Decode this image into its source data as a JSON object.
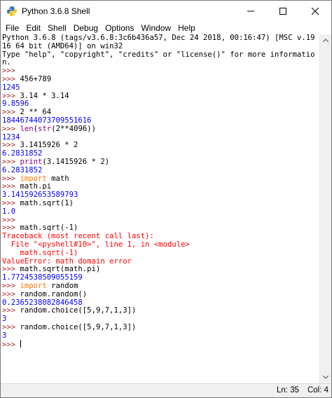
{
  "window": {
    "title": "Python 3.6.8 Shell"
  },
  "menu": [
    "File",
    "Edit",
    "Shell",
    "Debug",
    "Options",
    "Window",
    "Help"
  ],
  "shell_lines": [
    [
      {
        "t": "Python 3.6.8 (tags/v3.6.8:3c6b436a57, Dec 24 2018, 00:16:47) [MSC v.19",
        "c": "info"
      }
    ],
    [
      {
        "t": "16 64 bit (AMD64)] on win32",
        "c": "info"
      }
    ],
    [
      {
        "t": "Type \"help\", \"copyright\", \"credits\" or \"license()\" for more informatio",
        "c": "info"
      }
    ],
    [
      {
        "t": "n.",
        "c": "info"
      }
    ],
    [
      {
        "t": ">>> ",
        "c": "prompt"
      }
    ],
    [
      {
        "t": ">>> ",
        "c": "prompt"
      },
      {
        "t": "456+789",
        "c": "input"
      }
    ],
    [
      {
        "t": "1245",
        "c": "output"
      }
    ],
    [
      {
        "t": ">>> ",
        "c": "prompt"
      },
      {
        "t": "3.14 * 3.14",
        "c": "input"
      }
    ],
    [
      {
        "t": "9.8596",
        "c": "output"
      }
    ],
    [
      {
        "t": ">>> ",
        "c": "prompt"
      },
      {
        "t": "2 ** 64",
        "c": "input"
      }
    ],
    [
      {
        "t": "18446744073709551616",
        "c": "output"
      }
    ],
    [
      {
        "t": ">>> ",
        "c": "prompt"
      },
      {
        "t": "len",
        "c": "builtin"
      },
      {
        "t": "(",
        "c": "input"
      },
      {
        "t": "str",
        "c": "builtin"
      },
      {
        "t": "(2**4096))",
        "c": "input"
      }
    ],
    [
      {
        "t": "1234",
        "c": "output"
      }
    ],
    [
      {
        "t": ">>> ",
        "c": "prompt"
      },
      {
        "t": "3.1415926 * 2",
        "c": "input"
      }
    ],
    [
      {
        "t": "6.2831852",
        "c": "output"
      }
    ],
    [
      {
        "t": ">>> ",
        "c": "prompt"
      },
      {
        "t": "print",
        "c": "builtin"
      },
      {
        "t": "(3.1415926 * 2)",
        "c": "input"
      }
    ],
    [
      {
        "t": "6.2831852",
        "c": "output"
      }
    ],
    [
      {
        "t": ">>> ",
        "c": "prompt"
      },
      {
        "t": "import",
        "c": "kw"
      },
      {
        "t": " math",
        "c": "input"
      }
    ],
    [
      {
        "t": ">>> ",
        "c": "prompt"
      },
      {
        "t": "math.pi",
        "c": "input"
      }
    ],
    [
      {
        "t": "3.141592653589793",
        "c": "output"
      }
    ],
    [
      {
        "t": ">>> ",
        "c": "prompt"
      },
      {
        "t": "math.sqrt(1)",
        "c": "input"
      }
    ],
    [
      {
        "t": "1.0",
        "c": "output"
      }
    ],
    [
      {
        "t": ">>> ",
        "c": "prompt"
      }
    ],
    [
      {
        "t": ">>> ",
        "c": "prompt"
      },
      {
        "t": "math.sqrt(-1)",
        "c": "input"
      }
    ],
    [
      {
        "t": "Traceback (most recent call last):",
        "c": "error"
      }
    ],
    [
      {
        "t": "  File \"<pyshell#10>\", line 1, in <module>",
        "c": "error"
      }
    ],
    [
      {
        "t": "    math.sqrt(-1)",
        "c": "error"
      }
    ],
    [
      {
        "t": "ValueError: math domain error",
        "c": "error"
      }
    ],
    [
      {
        "t": ">>> ",
        "c": "prompt"
      },
      {
        "t": "math.sqrt(math.pi)",
        "c": "input"
      }
    ],
    [
      {
        "t": "1.7724538509055159",
        "c": "output"
      }
    ],
    [
      {
        "t": ">>> ",
        "c": "prompt"
      },
      {
        "t": "import",
        "c": "kw"
      },
      {
        "t": " random",
        "c": "input"
      }
    ],
    [
      {
        "t": ">>> ",
        "c": "prompt"
      },
      {
        "t": "random.random()",
        "c": "input"
      }
    ],
    [
      {
        "t": "0.2365238082846458",
        "c": "output"
      }
    ],
    [
      {
        "t": ">>> ",
        "c": "prompt"
      },
      {
        "t": "random.choice([5,9,7,1,3])",
        "c": "input"
      }
    ],
    [
      {
        "t": "3",
        "c": "output"
      }
    ],
    [
      {
        "t": ">>> ",
        "c": "prompt"
      },
      {
        "t": "random.choice([5,9,7,1,3])",
        "c": "input"
      }
    ],
    [
      {
        "t": "3",
        "c": "output"
      }
    ],
    [
      {
        "t": ">>> ",
        "c": "prompt"
      }
    ]
  ],
  "status": {
    "line": "Ln: 35",
    "col": "Col: 4"
  },
  "colors": {
    "prompt": "#a52a2a",
    "output": "#0000ff",
    "keyword": "#ff7700",
    "builtin": "#900090",
    "error": "#ff0000"
  },
  "icons": {
    "app": "python-icon",
    "minimize": "minimize-icon",
    "maximize": "maximize-icon",
    "close": "close-icon"
  }
}
